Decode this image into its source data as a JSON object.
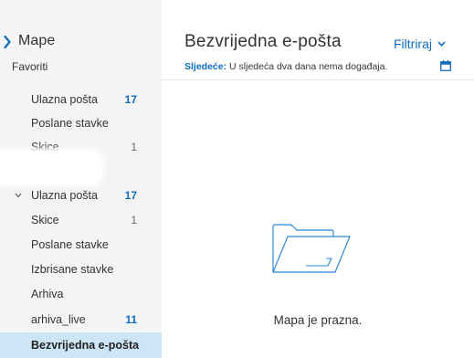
{
  "sidebar": {
    "mape_label": "Mape",
    "favorites_label": "Favoriti",
    "favorites": [
      {
        "label": "Ulazna pošta",
        "count": "17"
      },
      {
        "label": "Poslane stavke",
        "count": ""
      },
      {
        "label": "Skice",
        "count": "1"
      }
    ],
    "folders": [
      {
        "label": "Ulazna pošta",
        "count": "17"
      },
      {
        "label": "Skice",
        "count": "1"
      },
      {
        "label": "Poslane stavke",
        "count": ""
      },
      {
        "label": "Izbrisane stavke",
        "count": ""
      },
      {
        "label": "Arhiva",
        "count": ""
      },
      {
        "label": "arhiva_live",
        "count": "11"
      },
      {
        "label": "Bezvrijedna e-pošta",
        "count": ""
      }
    ]
  },
  "main": {
    "title": "Bezvrijedna e-pošta",
    "filter_label": "Filtriraj",
    "next_prefix": "Sljedeće:",
    "next_text": " U sljedeća dva dana nema događaja.",
    "empty_message": "Mapa je prazna."
  },
  "icons": {
    "mape": "chevron-icon",
    "expand": "chevron-down-icon",
    "filter": "chevron-down-icon",
    "calendar": "calendar-icon",
    "empty": "folder-icon"
  },
  "colors": {
    "accent": "#0f6cbd",
    "selected_bg": "#cde6f7",
    "sidebar_bg": "#f4f4f4"
  }
}
